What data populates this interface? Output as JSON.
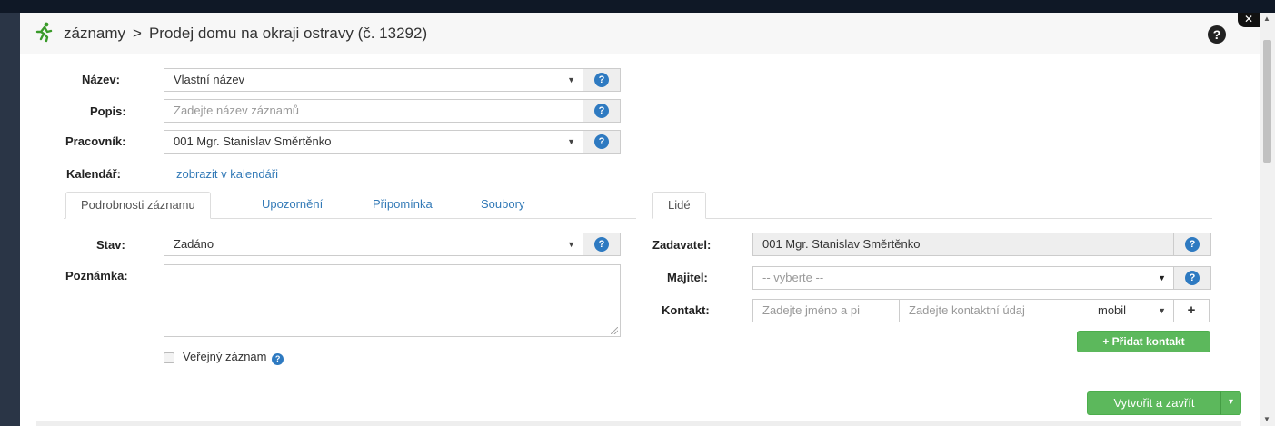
{
  "header": {
    "breadcrumb_root": "záznamy",
    "separator": ">",
    "title": "Prodej domu na okraji ostravy (č. 13292)",
    "close": "✕",
    "help": "?"
  },
  "form": {
    "nazev": {
      "label": "Název:",
      "value": "Vlastní název"
    },
    "popis": {
      "label": "Popis:",
      "placeholder": "Zadejte název záznamů"
    },
    "pracovnik": {
      "label": "Pracovník:",
      "value": "001 Mgr. Stanislav Směrtěnko"
    },
    "kalendar": {
      "label": "Kalendář:",
      "link": "zobrazit v kalendáři"
    }
  },
  "tabs_left": [
    {
      "label": "Podrobnosti záznamu",
      "active": true
    },
    {
      "label": "Upozornění"
    },
    {
      "label": "Připomínka"
    },
    {
      "label": "Soubory"
    }
  ],
  "tabs_right": [
    {
      "label": "Lidé",
      "active": true
    }
  ],
  "details": {
    "stav": {
      "label": "Stav:",
      "value": "Zadáno"
    },
    "poznamka": {
      "label": "Poznámka:"
    },
    "verejny": {
      "label": "Veřejný záznam",
      "checked": false
    }
  },
  "people": {
    "zadavatel": {
      "label": "Zadavatel:",
      "value": "001 Mgr. Stanislav Směrtěnko"
    },
    "majitel": {
      "label": "Majitel:",
      "value": "-- vyberte --"
    },
    "kontakt": {
      "label": "Kontakt:",
      "name_placeholder": "Zadejte jméno a pi",
      "detail_placeholder": "Zadejte kontaktní údaj",
      "type": "mobil",
      "add_symbol": "+"
    },
    "add_contact_button": "+ Přidat kontakt"
  },
  "footer": {
    "submit": "Vytvořit a zavřít"
  },
  "colors": {
    "link": "#337ab7",
    "help_icon": "#2e7ac1",
    "success": "#5cb85c",
    "run_icon": "#3a9a2a"
  },
  "icons": [
    "running-man-icon",
    "help-icon",
    "close-icon",
    "caret-down-icon",
    "plus-icon"
  ]
}
